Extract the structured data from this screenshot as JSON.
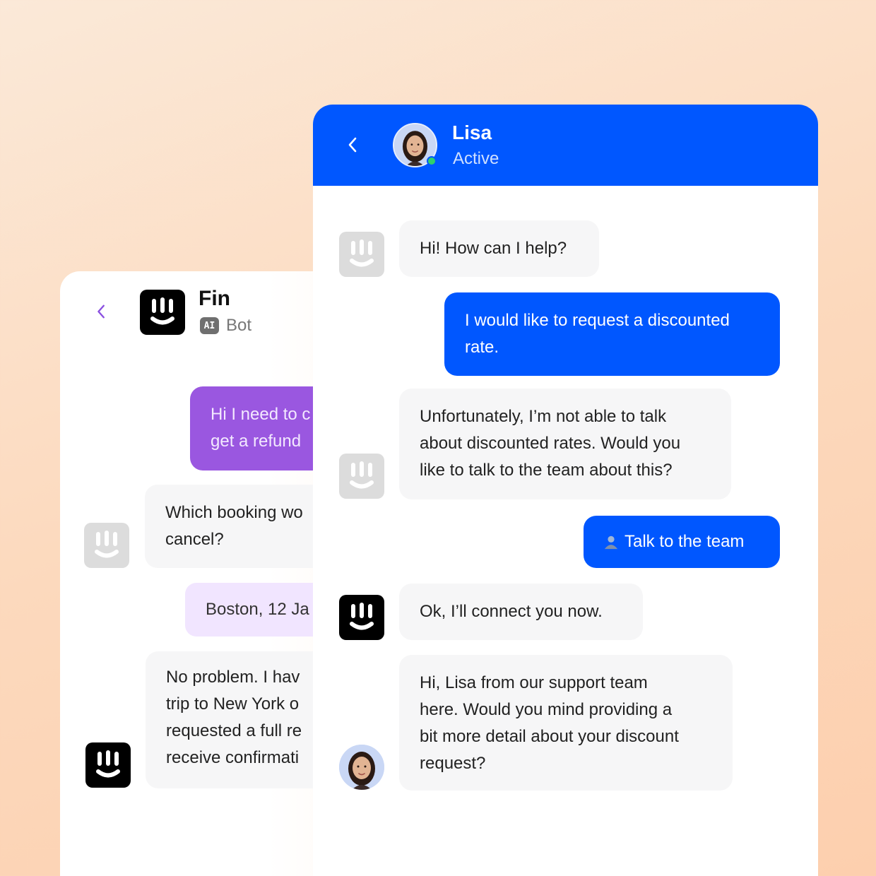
{
  "fin_chat": {
    "name": "Fin",
    "badge": "AI",
    "role": "Bot",
    "messages": [
      {
        "text_lines": [
          "Hi I need to c",
          "get a refund"
        ]
      },
      {
        "text_lines": [
          "Which booking wo",
          "cancel?"
        ]
      },
      {
        "text_lines": [
          "Boston, 12 Ja"
        ]
      },
      {
        "text_lines": [
          "No problem. I hav",
          "trip to New York o",
          "requested a full re",
          "receive confirmati"
        ]
      }
    ]
  },
  "lisa_chat": {
    "name": "Lisa",
    "status": "Active",
    "messages": {
      "m1": "Hi! How can I help?",
      "m2": [
        "I would like to request a discounted",
        "rate."
      ],
      "m3": [
        "Unfortunately, I’m not able to talk",
        "about discounted rates. Would you",
        "like to talk to the team about this?"
      ],
      "m4": "Talk to the team",
      "m5": "Ok, I’ll connect you now.",
      "m6": [
        "Hi, Lisa from our support team",
        "here. Would you mind providing a",
        "bit more detail about your discount",
        "request?"
      ]
    }
  },
  "colors": {
    "brand_blue": "#0057ff",
    "fin_purple": "#9a57e0",
    "light_purple": "#f1e5ff",
    "online_green": "#2fd06b"
  },
  "icons": {
    "back": "chevron-left-icon",
    "logo": "smiley-logo-icon",
    "person": "person-icon",
    "online": "online-dot-icon"
  }
}
